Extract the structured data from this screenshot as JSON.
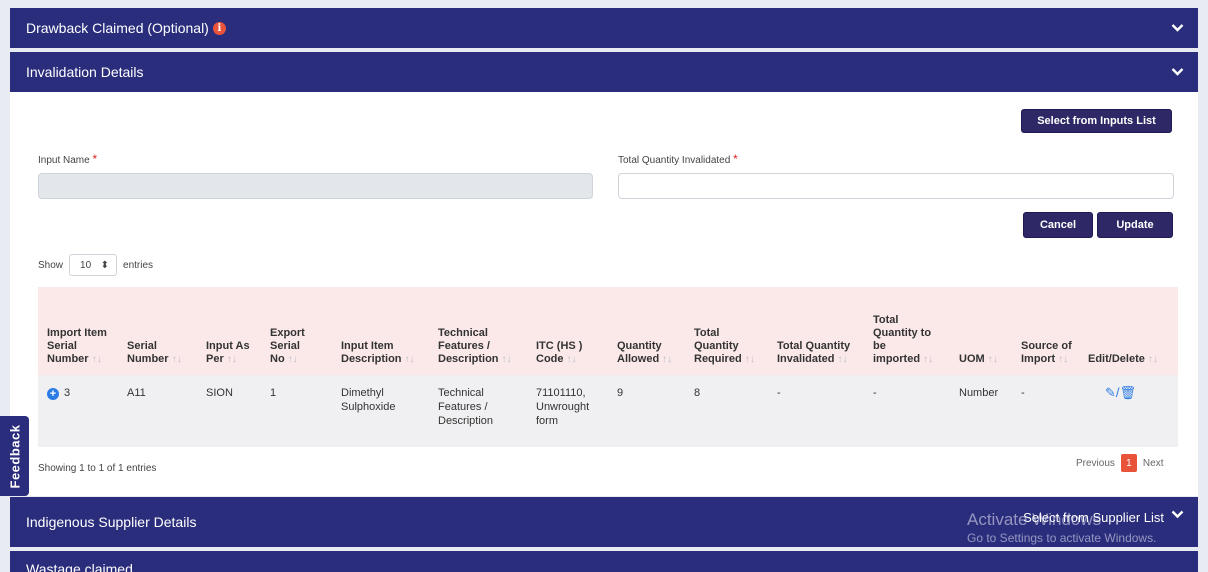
{
  "panels": {
    "drawback": "Drawback Claimed (Optional)",
    "invalidation": "Invalidation Details",
    "indigenous": "Indigenous Supplier Details",
    "wastage": "Wastage claimed"
  },
  "info_icon": "i",
  "buttons": {
    "select_inputs": "Select from Inputs List",
    "cancel": "Cancel",
    "update": "Update",
    "select_supplier": "Select from Supplier List"
  },
  "form": {
    "input_name_label": "Input Name",
    "total_qty_label": "Total Quantity Invalidated",
    "required_mark": "*",
    "input_name_value": "",
    "total_qty_value": ""
  },
  "length_menu": {
    "show": "Show",
    "value": "10",
    "entries": "entries"
  },
  "table": {
    "columns": [
      "Import Item Serial Number",
      "Serial Number",
      "Input As Per",
      "Export Serial No",
      "Input Item Description",
      "Technical Features / Description",
      "ITC (HS ) Code",
      "Quantity Allowed",
      "Total Quantity Required",
      "Total Quantity Invalidated",
      "Total Quantity to be imported",
      "UOM",
      "Source of Import",
      "Edit/Delete"
    ],
    "rows": [
      {
        "import_item_serial_number": "3",
        "serial_number": "A11",
        "input_as_per": "SION",
        "export_serial_no": "1",
        "input_item_description": "Dimethyl Sulphoxide",
        "technical_features": "Technical Features / Description",
        "itc_code": "71101110, Unwrought form",
        "quantity_allowed": "9",
        "total_quantity_required": "8",
        "total_quantity_invalidated": "-",
        "total_quantity_to_be_imported": "-",
        "uom": "Number",
        "source_of_import": "-"
      }
    ]
  },
  "info_text": "Showing 1 to 1 of 1 entries",
  "pagination": {
    "previous": "Previous",
    "current": "1",
    "next": "Next"
  },
  "feedback_label": "Feedback",
  "watermark": {
    "line1": "Activate Windows",
    "line2": "Go to Settings to activate Windows."
  },
  "colors": {
    "panel_header": "#2a2d7c",
    "button": "#2e2966",
    "table_header": "#fbe9ea",
    "page_active": "#e8533a",
    "icon_blue": "#2c7be5"
  }
}
